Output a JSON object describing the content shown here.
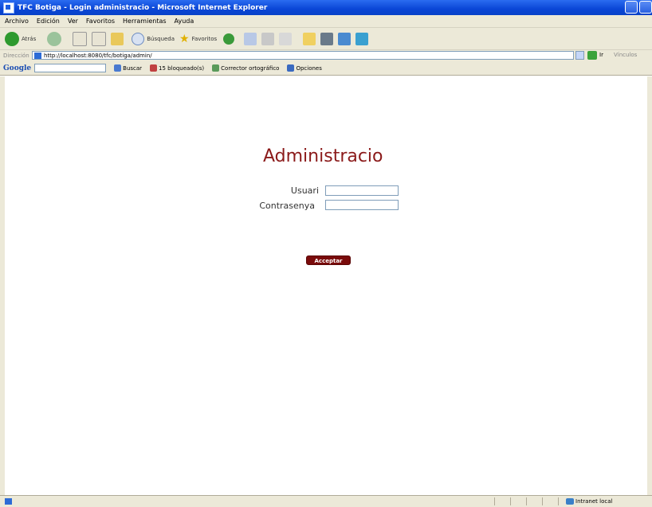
{
  "window": {
    "title": "TFC Botiga - Login administracio - Microsoft Internet Explorer"
  },
  "menu": [
    "Archivo",
    "Edición",
    "Ver",
    "Favoritos",
    "Herramientas",
    "Ayuda"
  ],
  "toolbar": {
    "back_label": "Atrás",
    "search_label": "Búsqueda",
    "favorites_label": "Favoritos"
  },
  "address": {
    "label": "Dirección",
    "url": "http://localhost:8080/tfc/botiga/admin/",
    "go_label": "Ir",
    "links_label": "Vínculos"
  },
  "googlebar": {
    "logo": "Google",
    "buscar": "Buscar",
    "blocked": "15 bloqueado(s)",
    "spell": "Corrector ortográfico",
    "options": "Opciones"
  },
  "login": {
    "title": "Administracio",
    "user_label": "Usuari",
    "password_label": "Contrasenya",
    "user_value": "",
    "password_value": "",
    "submit_label": "Acceptar"
  },
  "status": {
    "zone": "Intranet local"
  },
  "colors": {
    "accent": "#8b1a1a",
    "button": "#7a0b0b",
    "titlebar": "#0a46d6"
  }
}
